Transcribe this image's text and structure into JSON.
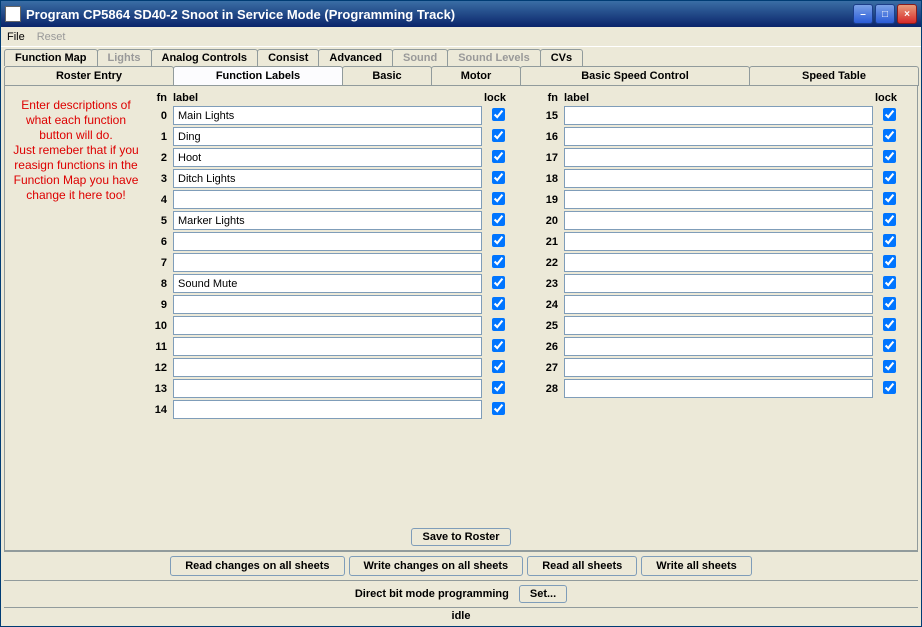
{
  "window_title": "Program CP5864 SD40-2 Snoot in Service Mode (Programming Track)",
  "menu": {
    "file": "File",
    "reset": "Reset"
  },
  "tabs1": {
    "function_map": "Function Map",
    "lights": "Lights",
    "analog_controls": "Analog Controls",
    "consist": "Consist",
    "advanced": "Advanced",
    "sound": "Sound",
    "sound_levels": "Sound Levels",
    "cvs": "CVs"
  },
  "tabs2": {
    "roster_entry": "Roster Entry",
    "function_labels": "Function Labels",
    "basic": "Basic",
    "motor": "Motor",
    "basic_speed_control": "Basic Speed Control",
    "speed_table": "Speed Table"
  },
  "hint_text": "Enter descriptions of what each function button will do.\nJust remeber that if you reasign functions in the Function Map you have change it here too!",
  "headers": {
    "fn": "fn",
    "label": "label",
    "lock": "lock"
  },
  "rows_left": [
    {
      "fn": "0",
      "label": "Main Lights",
      "lock": true
    },
    {
      "fn": "1",
      "label": "Ding",
      "lock": true
    },
    {
      "fn": "2",
      "label": "Hoot",
      "lock": true
    },
    {
      "fn": "3",
      "label": "Ditch Lights",
      "lock": true
    },
    {
      "fn": "4",
      "label": "",
      "lock": true
    },
    {
      "fn": "5",
      "label": "Marker Lights",
      "lock": true
    },
    {
      "fn": "6",
      "label": "",
      "lock": true
    },
    {
      "fn": "7",
      "label": "",
      "lock": true
    },
    {
      "fn": "8",
      "label": "Sound Mute",
      "lock": true
    },
    {
      "fn": "9",
      "label": "",
      "lock": true
    },
    {
      "fn": "10",
      "label": "",
      "lock": true
    },
    {
      "fn": "11",
      "label": "",
      "lock": true
    },
    {
      "fn": "12",
      "label": "",
      "lock": true
    },
    {
      "fn": "13",
      "label": "",
      "lock": true
    },
    {
      "fn": "14",
      "label": "",
      "lock": true
    }
  ],
  "rows_right": [
    {
      "fn": "15",
      "label": "",
      "lock": true
    },
    {
      "fn": "16",
      "label": "",
      "lock": true
    },
    {
      "fn": "17",
      "label": "",
      "lock": true
    },
    {
      "fn": "18",
      "label": "",
      "lock": true
    },
    {
      "fn": "19",
      "label": "",
      "lock": true
    },
    {
      "fn": "20",
      "label": "",
      "lock": true
    },
    {
      "fn": "21",
      "label": "",
      "lock": true
    },
    {
      "fn": "22",
      "label": "",
      "lock": true
    },
    {
      "fn": "23",
      "label": "",
      "lock": true
    },
    {
      "fn": "24",
      "label": "",
      "lock": true
    },
    {
      "fn": "25",
      "label": "",
      "lock": true
    },
    {
      "fn": "26",
      "label": "",
      "lock": true
    },
    {
      "fn": "27",
      "label": "",
      "lock": true
    },
    {
      "fn": "28",
      "label": "",
      "lock": true
    }
  ],
  "buttons": {
    "save_to_roster": "Save to Roster",
    "read_changes": "Read changes on all sheets",
    "write_changes": "Write changes on all sheets",
    "read_all": "Read all sheets",
    "write_all": "Write all sheets",
    "set": "Set..."
  },
  "mode_text": "Direct bit mode programming",
  "status": "idle"
}
